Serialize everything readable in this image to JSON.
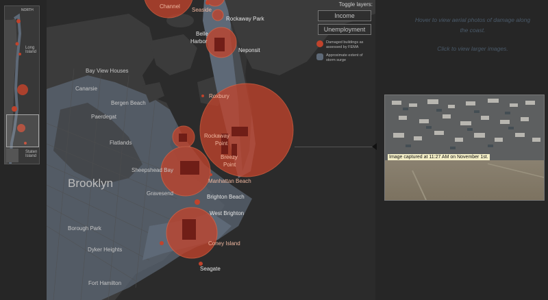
{
  "minimap": {
    "north_label": "NORTH",
    "long_island_label": "Long Island",
    "staten_island_label": "Staten Island"
  },
  "map": {
    "labels": {
      "channel": "Channel",
      "seaside": "Seaside",
      "rockaway_park": "Rockaway Park",
      "belle_harbor": "Belle Harbor",
      "neponsit": "Neponsit",
      "bay_view_houses": "Bay View Houses",
      "canarsie": "Canarsie",
      "bergen_beach": "Bergen Beach",
      "roxbury": "Roxbury",
      "paerdegat": "Paerdegat",
      "rockaway_point": "Rockaway Point",
      "flatlands": "Flatlands",
      "breezy_point": "Breezy Point",
      "sheepshead_bay": "Sheepshead Bay",
      "brooklyn": "Brooklyn",
      "manhattan_beach": "Manhattan Beach",
      "gravesend": "Gravesend",
      "brighton_beach": "Brighton Beach",
      "west_brighton": "West Brighton",
      "borough_park": "Borough Park",
      "coney_island": "Coney Island",
      "dyker_heights": "Dyker Heights",
      "seagate": "Seagate",
      "fort_hamilton": "Fort Hamilton"
    }
  },
  "layers": {
    "title": "Toggle layers:",
    "income_button": "Income",
    "unemployment_button": "Unemployment",
    "legend_damaged": "Damaged buildings as assessed by FEMA",
    "legend_surge": "Approximate extent of storm surge"
  },
  "info": {
    "line1": "Hover to view aerial photos of damage along the coast.",
    "line2": "Click to view larger images."
  },
  "photo": {
    "caption": "Image captured at 11:27 AM on November 1st."
  },
  "colors": {
    "damage": "#c0432c",
    "surge": "#5e6977",
    "land": "#3c3c3c",
    "water": "#2b2b2b"
  }
}
